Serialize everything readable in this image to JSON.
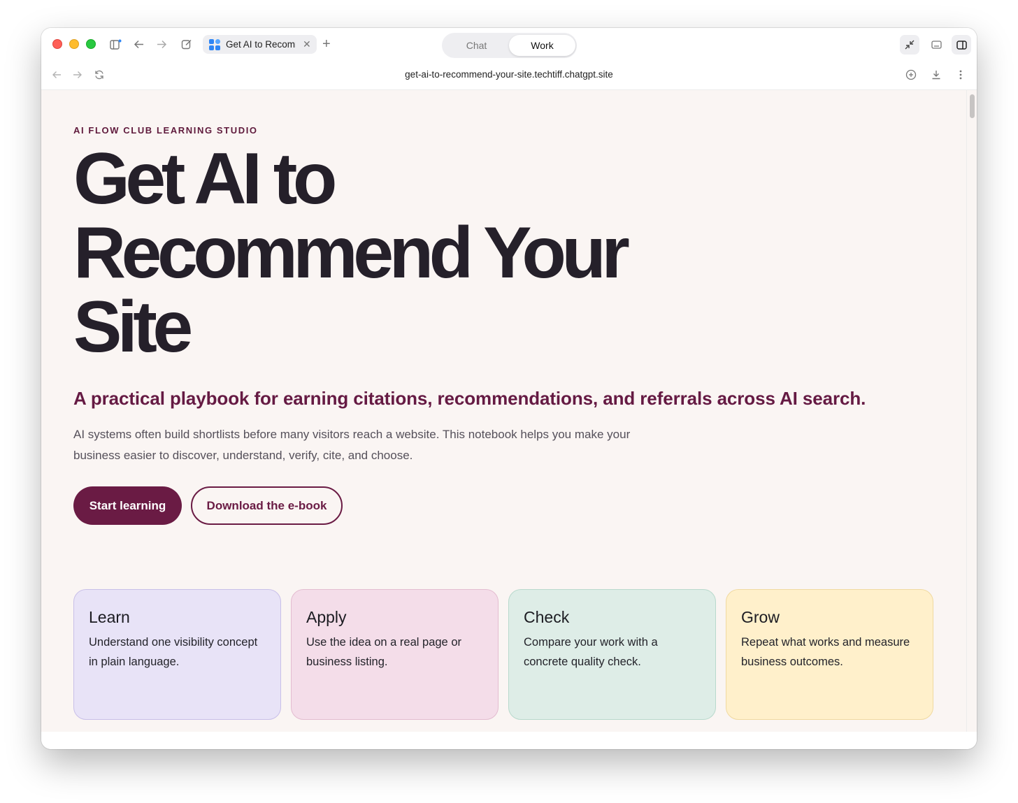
{
  "browser": {
    "tab_title": "Get AI to Recommend Your Site",
    "mode_options": [
      "Chat",
      "Work"
    ],
    "active_mode": "Work",
    "url": "get-ai-to-recommend-your-site.techtiff.chatgpt.site"
  },
  "page": {
    "eyebrow": "AI FLOW CLUB LEARNING STUDIO",
    "hero_title": "Get AI to Recommend Your Site",
    "subheadline": "A practical playbook for earning citations, recommendations, and referrals across AI search.",
    "intro": "AI systems often build shortlists before many visitors reach a website. This notebook helps you make your business easier to discover, understand, verify, cite, and choose.",
    "primary_cta": "Start learning",
    "secondary_cta": "Download the e-book",
    "cards": [
      {
        "title": "Learn",
        "text": "Understand one visibility concept in plain language."
      },
      {
        "title": "Apply",
        "text": "Use the idea on a real page or business listing."
      },
      {
        "title": "Check",
        "text": "Compare your work with a concrete quality check."
      },
      {
        "title": "Grow",
        "text": "Repeat what works and measure business outcomes."
      }
    ]
  },
  "colors": {
    "brand": "#6a1b44",
    "learn_card": "#e8e3f7",
    "apply_card": "#f4dde9",
    "check_card": "#deede7",
    "grow_card": "#fff0cb",
    "page_background": "#faf5f3"
  },
  "icons": [
    "sidebar-toggle-icon",
    "back-icon",
    "forward-icon",
    "compose-icon",
    "close-icon",
    "new-tab-icon",
    "collapse-icon",
    "window-icon",
    "side-panel-icon",
    "reload-icon",
    "add-comment-icon",
    "download-icon",
    "more-icon"
  ]
}
